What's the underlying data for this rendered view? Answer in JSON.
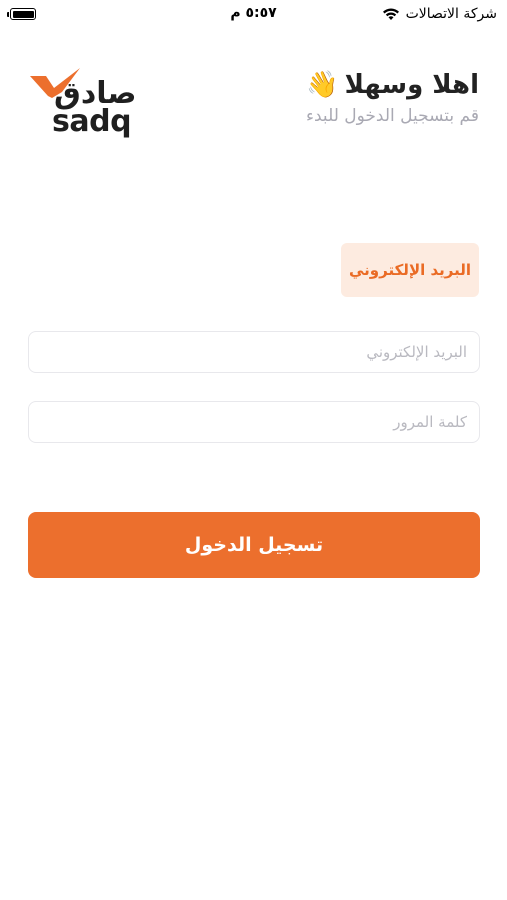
{
  "status_bar": {
    "time": "٥:٥٧ م",
    "carrier": "شركة الاتصالات",
    "battery_icon": "battery-icon",
    "wifi_icon": "wifi-icon"
  },
  "header": {
    "logo_ar": "صادق",
    "logo_en": "sadq",
    "title": "اهلا وسهلا",
    "wave_emoji": "👋",
    "subtitle": "قم بتسجيل الدخول للبدء"
  },
  "tabs": {
    "email_label": "البريد الإلكتروني"
  },
  "form": {
    "email_placeholder": "البريد الإلكتروني",
    "email_value": "",
    "password_placeholder": "كلمة المرور",
    "password_value": "",
    "submit_label": "تسجيل الدخول"
  },
  "colors": {
    "accent": "#ec6f2d",
    "tab_bg": "#fdebe0",
    "placeholder": "#b9b9c0"
  }
}
